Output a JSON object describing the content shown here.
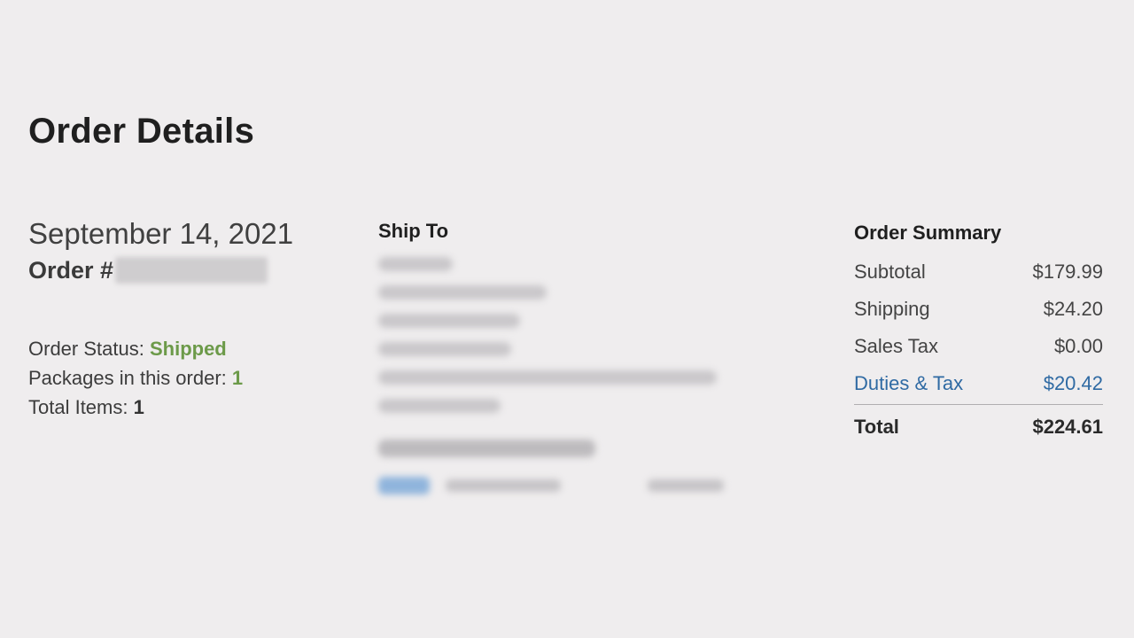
{
  "page": {
    "title": "Order Details"
  },
  "order": {
    "date": "September 14, 2021",
    "number_prefix": "Order #",
    "status_label": "Order Status:",
    "status_value": "Shipped",
    "packages_label": "Packages in this order:",
    "packages_value": "1",
    "items_label": "Total Items:",
    "items_value": "1"
  },
  "shipping": {
    "heading": "Ship To"
  },
  "summary": {
    "heading": "Order Summary",
    "rows": [
      {
        "label": "Subtotal",
        "value": "$179.99"
      },
      {
        "label": "Shipping",
        "value": "$24.20"
      },
      {
        "label": "Sales Tax",
        "value": "$0.00"
      },
      {
        "label": "Duties & Tax",
        "value": "$20.42"
      }
    ],
    "total_label": "Total",
    "total_value": "$224.61"
  },
  "colors": {
    "background": "#efedee",
    "status_green": "#6c9a49",
    "link_blue": "#2f6aa3"
  }
}
